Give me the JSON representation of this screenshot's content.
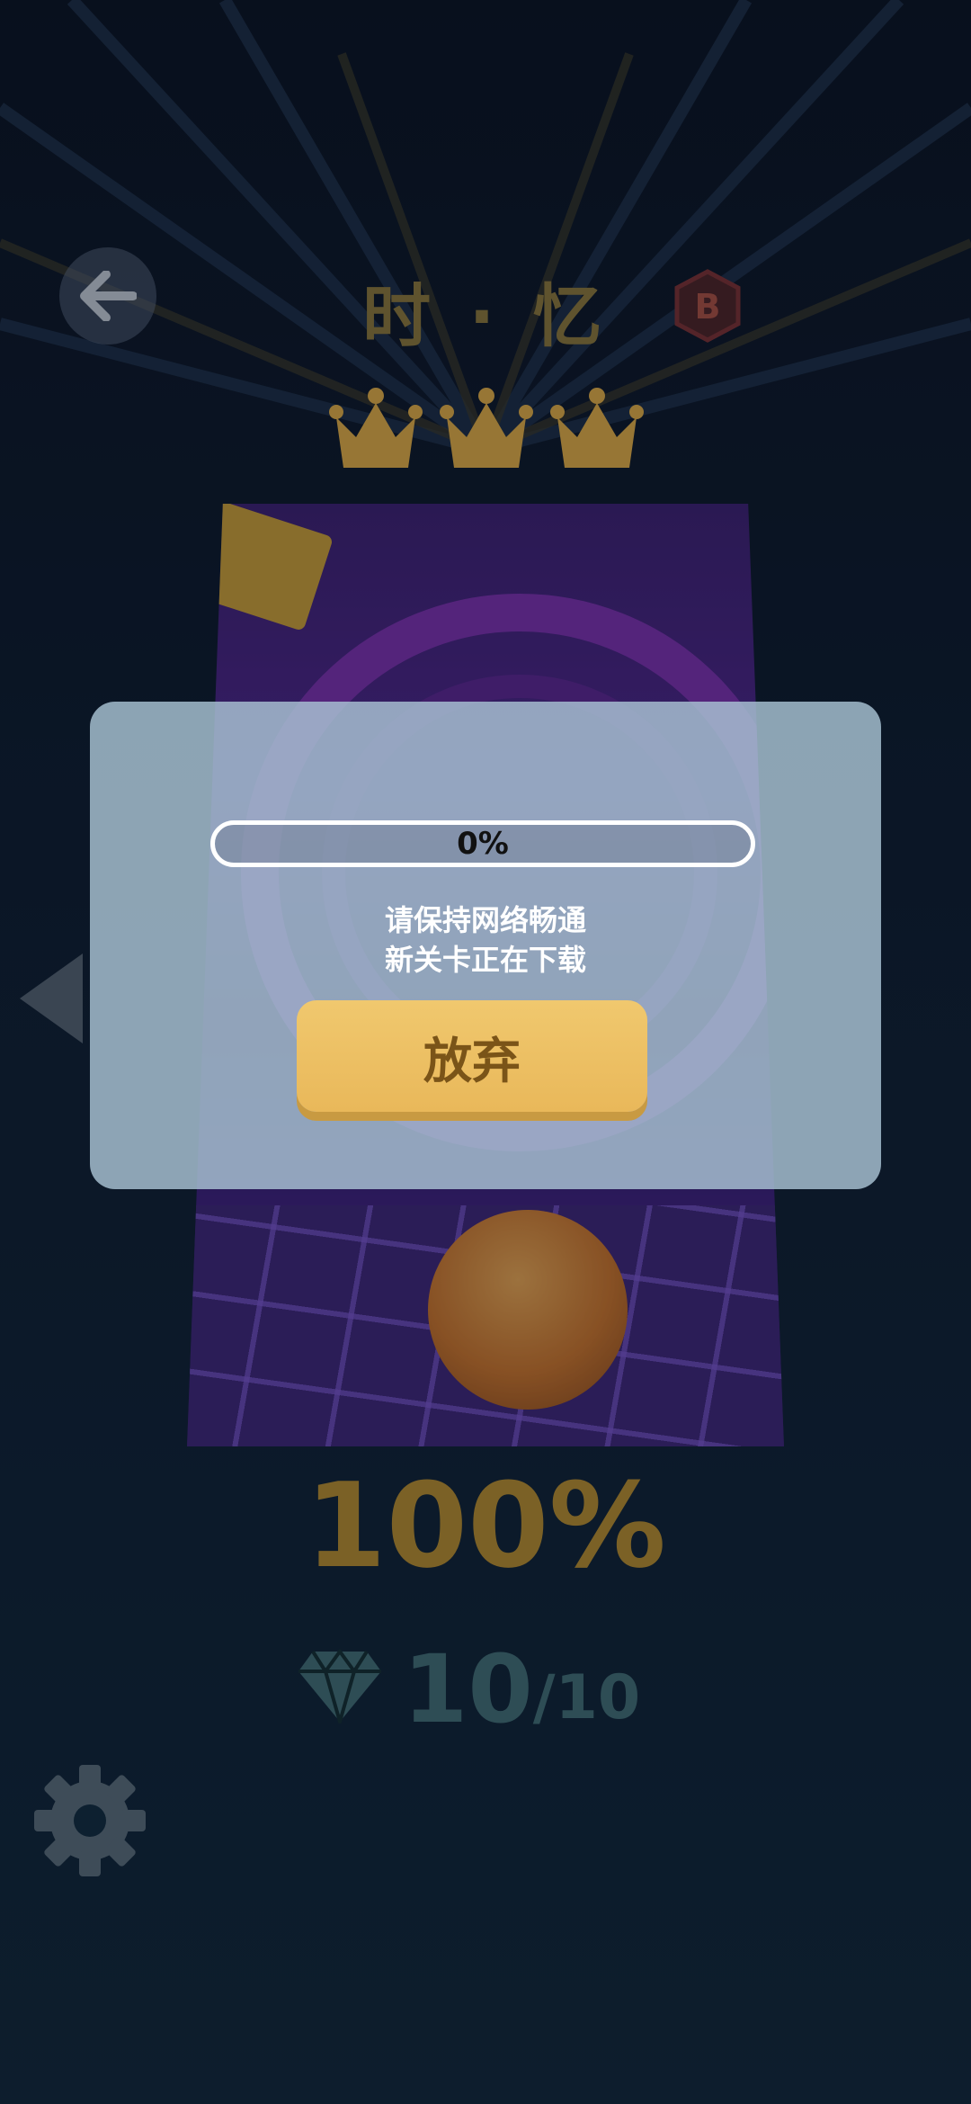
{
  "level": {
    "title": "时 · 忆",
    "difficulty_badge": "B",
    "crowns_earned": 3,
    "crowns_total": 3,
    "best_progress": "100%",
    "gems": {
      "collected": "10",
      "total": "/10"
    }
  },
  "download_dialog": {
    "progress_text": "0%",
    "progress_value": 0,
    "message_line1": "请保持网络畅通",
    "message_line2": "新关卡正在下载",
    "give_up_label": "放弃"
  },
  "colors": {
    "gold": "#e9b85a",
    "title_gold": "#8a7232",
    "badge_red": "#7a2a2a",
    "gem_teal": "#2e4d55"
  },
  "icons": {
    "back": "back-arrow-icon",
    "badge": "hexagon-badge-icon",
    "crown": "crown-icon",
    "gem": "diamond-icon",
    "settings": "gear-icon",
    "prev": "left-triangle-icon"
  }
}
